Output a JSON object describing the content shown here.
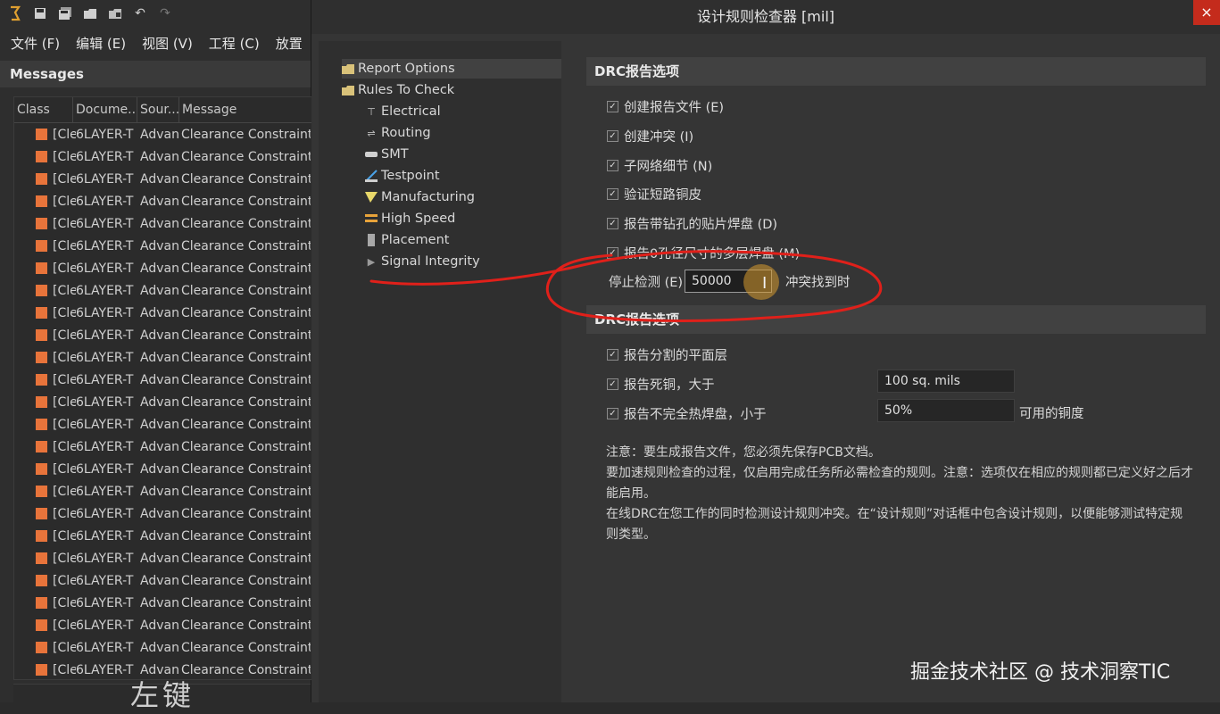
{
  "toolbar": {
    "icons": [
      "app-logo-icon",
      "save-icon",
      "save-all-icon",
      "open-folder-icon",
      "open-project-icon",
      "undo-icon",
      "redo-icon"
    ]
  },
  "menubar": {
    "items": [
      "文件 (F)",
      "编辑 (E)",
      "视图 (V)",
      "工程 (C)",
      "放置"
    ]
  },
  "messages": {
    "title": "Messages",
    "columns": [
      "Class",
      "Docume...",
      "Sour...",
      "Message"
    ],
    "row": {
      "class": "[Cle",
      "document": "6LAYER-T",
      "source": "Advan",
      "message": "Clearance Constraint:"
    },
    "row_count": 25
  },
  "handwritten_text": "左键",
  "dialog": {
    "title": "设计规则检查器 [mil]",
    "close_label": "×",
    "tree": {
      "report_options": "Report Options",
      "rules_to_check": "Rules To Check",
      "children": [
        "Electrical",
        "Routing",
        "SMT",
        "Testpoint",
        "Manufacturing",
        "High Speed",
        "Placement",
        "Signal Integrity"
      ]
    },
    "section1": {
      "title": "DRC报告选项",
      "checkboxes": [
        "创建报告文件 (E)",
        "创建冲突 (I)",
        "子网络细节 (N)",
        "验证短路铜皮",
        "报告带钻孔的贴片焊盘 (D)",
        "报告0孔径尺寸的多层焊盘 (M)"
      ],
      "stop_label": "停止检测 (E)",
      "stop_value": "50000",
      "stop_suffix": "冲突找到时"
    },
    "section2": {
      "title": "DRC报告选项",
      "checkboxes": [
        "报告分割的平面层",
        "报告死铜，大于",
        "报告不完全热焊盘，小于"
      ],
      "dead_copper_value": "100 sq. mils",
      "thermal_value": "50%",
      "thermal_suffix": "可用的铜度"
    },
    "notes": [
      "注意：要生成报告文件，您必须先保存PCB文档。",
      "要加速规则检查的过程，仅启用完成任务所必需检查的规则。注意：选项仅在相应的规则都已定义好之后才能启用。",
      "在线DRC在您工作的同时检测设计规则冲突。在“设计规则”对话框中包含设计规则，以便能够测试特定规则类型。"
    ]
  },
  "watermark": "掘金技术社区 @ 技术洞察TIC",
  "colors": {
    "error_marker": "#e8743b",
    "annotation": "#e0201a",
    "close": "#c42b1c"
  }
}
